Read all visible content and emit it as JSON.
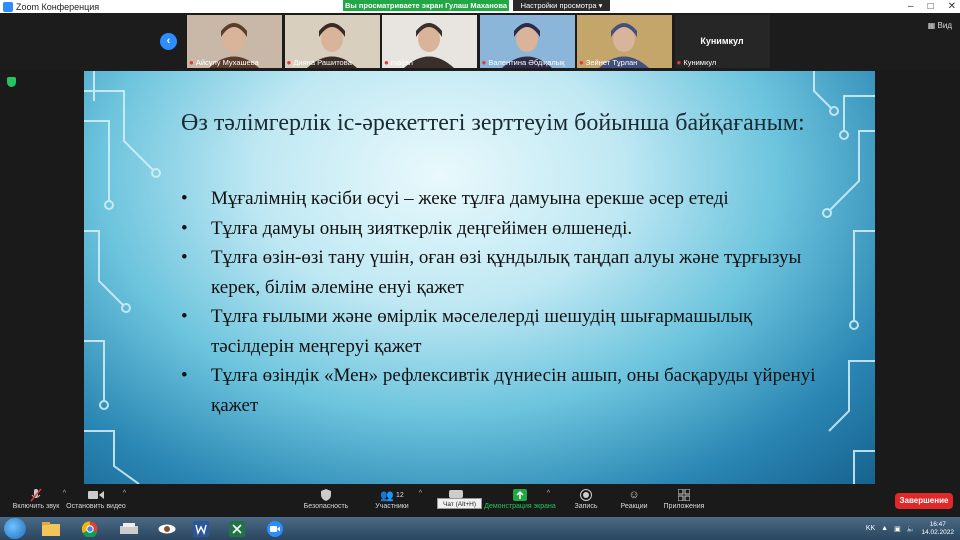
{
  "window": {
    "title": "Zoom Конференция",
    "sharing_banner": "Вы просматриваете экран Гулаш Маханова",
    "view_settings": "Настройки просмотра",
    "view_toggle": "Вид"
  },
  "participants": [
    {
      "name": "Айсулу Мухашева",
      "muted": true,
      "video": true,
      "palette": [
        "#c9b7a7",
        "#5a3c2c"
      ]
    },
    {
      "name": "Дияна Рашитова",
      "muted": true,
      "video": true,
      "palette": [
        "#d8cfbf",
        "#3a2a24"
      ]
    },
    {
      "name": "maijan",
      "muted": true,
      "video": true,
      "palette": [
        "#e8e4df",
        "#3b2f2b"
      ]
    },
    {
      "name": "Валентина Әбдіқалық",
      "muted": true,
      "video": true,
      "palette": [
        "#8bb6d9",
        "#2c2a45"
      ]
    },
    {
      "name": "Зейнет Тұрлан",
      "muted": true,
      "video": true,
      "palette": [
        "#c4a66a",
        "#41507d"
      ]
    },
    {
      "name": "Кунимкул",
      "muted": true,
      "video": false,
      "display_name": "Кунимкул"
    }
  ],
  "slide": {
    "title": "Өз тәлімгерлік іс-әрекеттегі зерттеуім бойынша байқағаным:",
    "bullets": [
      "Мұғалімнің кәсіби өсуі – жеке тұлға дамуына ерекше әсер етеді",
      "Тұлға дамуы оның зияткерлік деңгейімен өлшенеді.",
      "Тұлға өзін-өзі тану үшін, оған өзі құндылық таңдап алуы және тұрғызуы керек, білім әлеміне енуі қажет",
      "Тұлға ғылыми және өмірлік мәселелерді шешудің шығармашылық тәсілдерін меңгеруі қажет",
      "Тұлға өзіндік «Мен» рефлексивтік дүниесін ашып, оны басқаруды үйренуі қажет"
    ]
  },
  "toolbar": {
    "audio": "Включить звук",
    "video": "Остановить видео",
    "security": "Безопасность",
    "participants": "Участники",
    "participants_count": "12",
    "chat": "Чат",
    "chat_tooltip": "Чат (Alt+H)",
    "share": "Демонстрация экрана",
    "record": "Запись",
    "reactions": "Реакции",
    "apps": "Приложения",
    "end": "Завершение"
  },
  "taskbar": {
    "language": "KK",
    "time": "16:47",
    "date": "14.02.2022"
  },
  "colors": {
    "share_banner": "#22a745",
    "end_button": "#e02828",
    "accent": "#2d8cff"
  }
}
